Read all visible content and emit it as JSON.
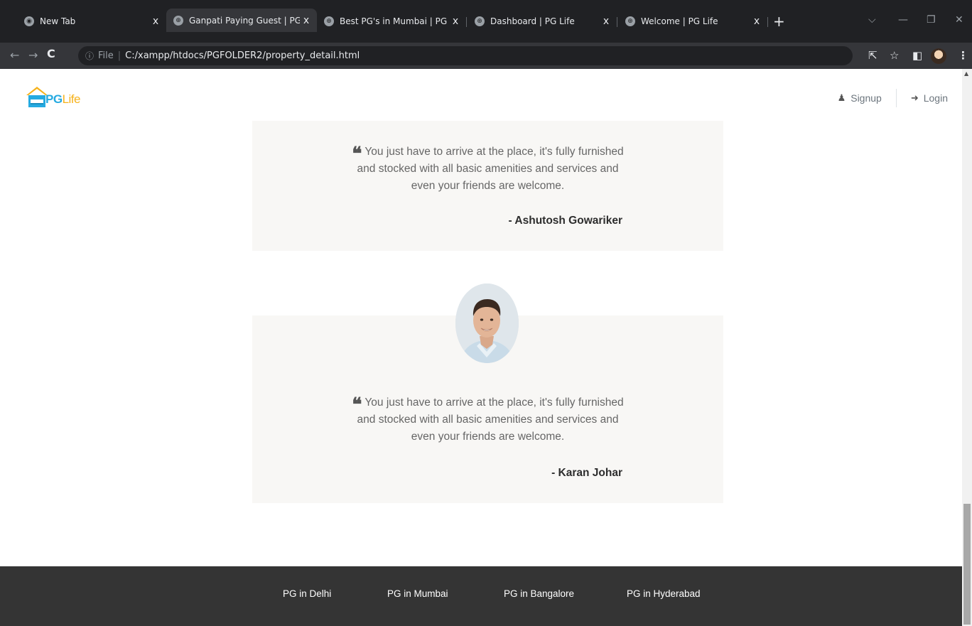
{
  "browser": {
    "tabs": [
      {
        "title": "New Tab",
        "active": false
      },
      {
        "title": "Ganpati Paying Guest | PG Life",
        "active": true
      },
      {
        "title": "Best PG's in Mumbai | PG Life",
        "active": false
      },
      {
        "title": "Dashboard | PG Life",
        "active": false
      },
      {
        "title": "Welcome | PG Life",
        "active": false
      }
    ],
    "close_glyph": "x",
    "new_tab_glyph": "+",
    "address": {
      "scheme_label": "File",
      "separator": "|",
      "url": "C:/xampp/htdocs/PGFOLDER2/property_detail.html"
    }
  },
  "header": {
    "logo": {
      "pg": "PG",
      "life": "Life"
    },
    "nav": {
      "signup_label": "Signup",
      "login_label": "Login"
    }
  },
  "testimonials": [
    {
      "quote_line1": "You just have to arrive at the place, it's fully furnished",
      "quote_line2": "and stocked with all basic amenities and services and",
      "quote_line3": "even your friends are welcome.",
      "author": "- Ashutosh Gowariker"
    },
    {
      "quote_line1": "You just have to arrive at the place, it's fully furnished",
      "quote_line2": "and stocked with all basic amenities and services and",
      "quote_line3": "even your friends are welcome.",
      "author": "- Karan Johar"
    }
  ],
  "footer": {
    "links": [
      {
        "label": "PG in Delhi"
      },
      {
        "label": "PG in Mumbai"
      },
      {
        "label": "PG in Bangalore"
      },
      {
        "label": "PG in Hyderabad"
      }
    ]
  },
  "colors": {
    "brand_blue": "#25aae1",
    "brand_yellow": "#f6b21b",
    "testimonial_bg": "#f8f7f5",
    "footer_bg": "#343434"
  }
}
